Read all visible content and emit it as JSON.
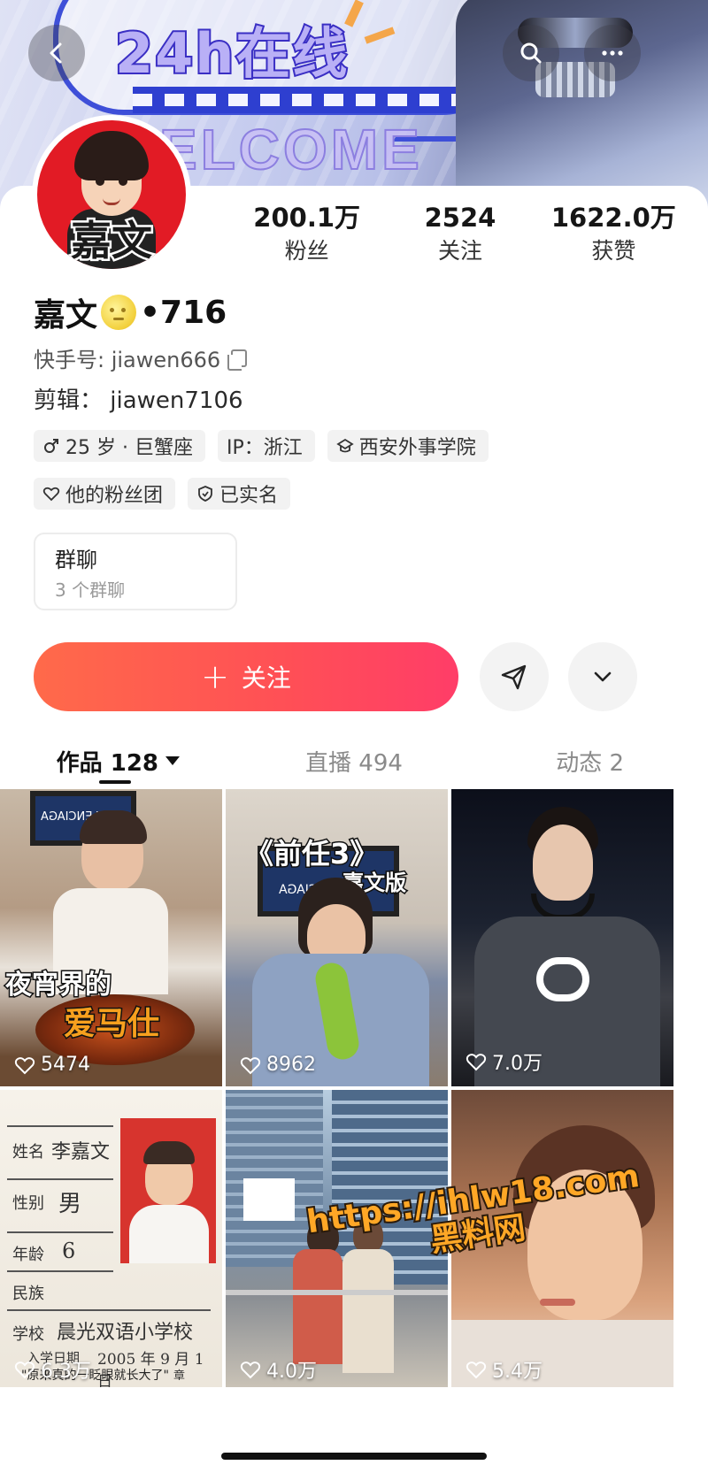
{
  "banner": {
    "headline": "24h在线",
    "welcome": "ELCOME"
  },
  "profile": {
    "avatar_text": "嘉文",
    "name": "嘉文",
    "name_score": "•716",
    "kuaishou_id": "快手号: jiawen666",
    "bio": "剪辑： jiawen7106"
  },
  "stats": [
    {
      "value": "200.1万",
      "label": "粉丝"
    },
    {
      "value": "2524",
      "label": "关注"
    },
    {
      "value": "1622.0万",
      "label": "获赞"
    }
  ],
  "tags": {
    "age": "25 岁 · 巨蟹座",
    "ip": "IP：浙江",
    "school": "西安外事学院",
    "fan_group": "他的粉丝团",
    "verified": "已实名"
  },
  "group_chat": {
    "title": "群聊",
    "subtitle": "3 个群聊"
  },
  "actions": {
    "follow_label": "关注",
    "plus": "+"
  },
  "tabs": [
    {
      "label": "作品 128"
    },
    {
      "label": "直播 494"
    },
    {
      "label": "动态 2"
    }
  ],
  "videos": [
    {
      "likes": "5474",
      "title_line1": "夜宵界的",
      "title_line2": "爱马仕",
      "tv_text": "BALENCIAGA"
    },
    {
      "likes": "8962",
      "title_line1": "《前任3》",
      "title_line2": "嘉文版",
      "tv_text": "BALENCIAGA"
    },
    {
      "likes": "7.0万"
    },
    {
      "likes": "6.3万",
      "form": {
        "name_label": "姓名",
        "name_value": "李嘉文",
        "gender_label": "性别",
        "gender_value": "男",
        "age_label": "年龄",
        "age_value": "6",
        "ethnic_label": "民族",
        "school_label": "学校",
        "school_value": "晨光双语小学校",
        "date_label": "入学日期",
        "date_value": "2005 年 9 月 1 日",
        "caption": "\"原来真的一眨眼就长大了\"",
        "stamp": "章"
      }
    },
    {
      "likes": "4.0万"
    },
    {
      "likes": "5.4万"
    }
  ],
  "watermark": {
    "line1": "https://ihlw18.com",
    "line2": "黑料网"
  },
  "colors": {
    "follow_gradient_start": "#ff6a4a",
    "follow_gradient_end": "#ff3d68",
    "avatar_bg": "#e21b25",
    "banner_accent": "#3e4fd8"
  }
}
